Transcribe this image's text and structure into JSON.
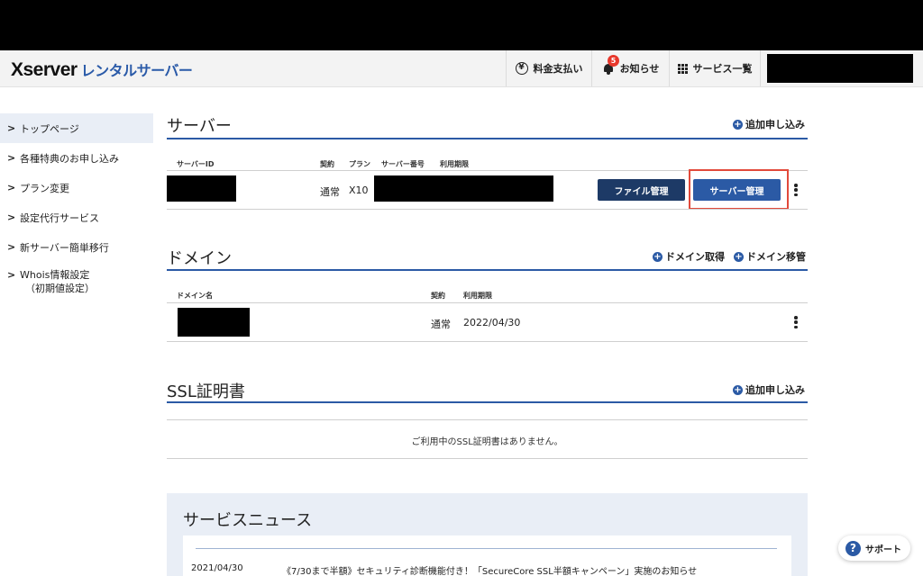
{
  "header": {
    "logo_main": "Xserver",
    "logo_sub": "レンタルサーバー",
    "nav": {
      "payment": "料金支払い",
      "notice": "お知らせ",
      "notice_badge": "5",
      "services": "サービス一覧"
    }
  },
  "sidebar": {
    "items": [
      {
        "label": "トップページ"
      },
      {
        "label": "各種特典のお申し込み"
      },
      {
        "label": "プラン変更"
      },
      {
        "label": "設定代行サービス"
      },
      {
        "label": "新サーバー簡単移行"
      },
      {
        "label": "Whois情報設定",
        "label2": "（初期値設定）"
      }
    ],
    "chevron": ">"
  },
  "server": {
    "title": "サーバー",
    "add_link": "追加申し込み",
    "columns": {
      "id": "サーバーID",
      "contract": "契約",
      "plan": "プラン",
      "number": "サーバー番号",
      "period": "利用期限"
    },
    "row": {
      "contract": "通常",
      "plan": "X10"
    },
    "file_button": "ファイル管理",
    "manage_button": "サーバー管理"
  },
  "domain": {
    "title": "ドメイン",
    "acquire_link": "ドメイン取得",
    "transfer_link": "ドメイン移管",
    "columns": {
      "name": "ドメイン名",
      "contract": "契約",
      "period": "利用期限"
    },
    "row": {
      "contract": "通常",
      "period": "2022/04/30"
    }
  },
  "ssl": {
    "title": "SSL証明書",
    "add_link": "追加申し込み",
    "empty_message": "ご利用中のSSL証明書はありません。"
  },
  "news": {
    "title": "サービスニュース",
    "items": [
      {
        "date": "2021/04/30",
        "text": "《7/30まで半額》セキュリティ診断機能付き！「SecureCore SSL半額キャンペーン」実施のお知らせ"
      }
    ]
  },
  "support": {
    "label": "サポート"
  },
  "colors": {
    "accent": "#2b5aa5",
    "dark_button": "#1d3a66",
    "highlight": "#e24a3b",
    "badge": "#e8382c"
  }
}
